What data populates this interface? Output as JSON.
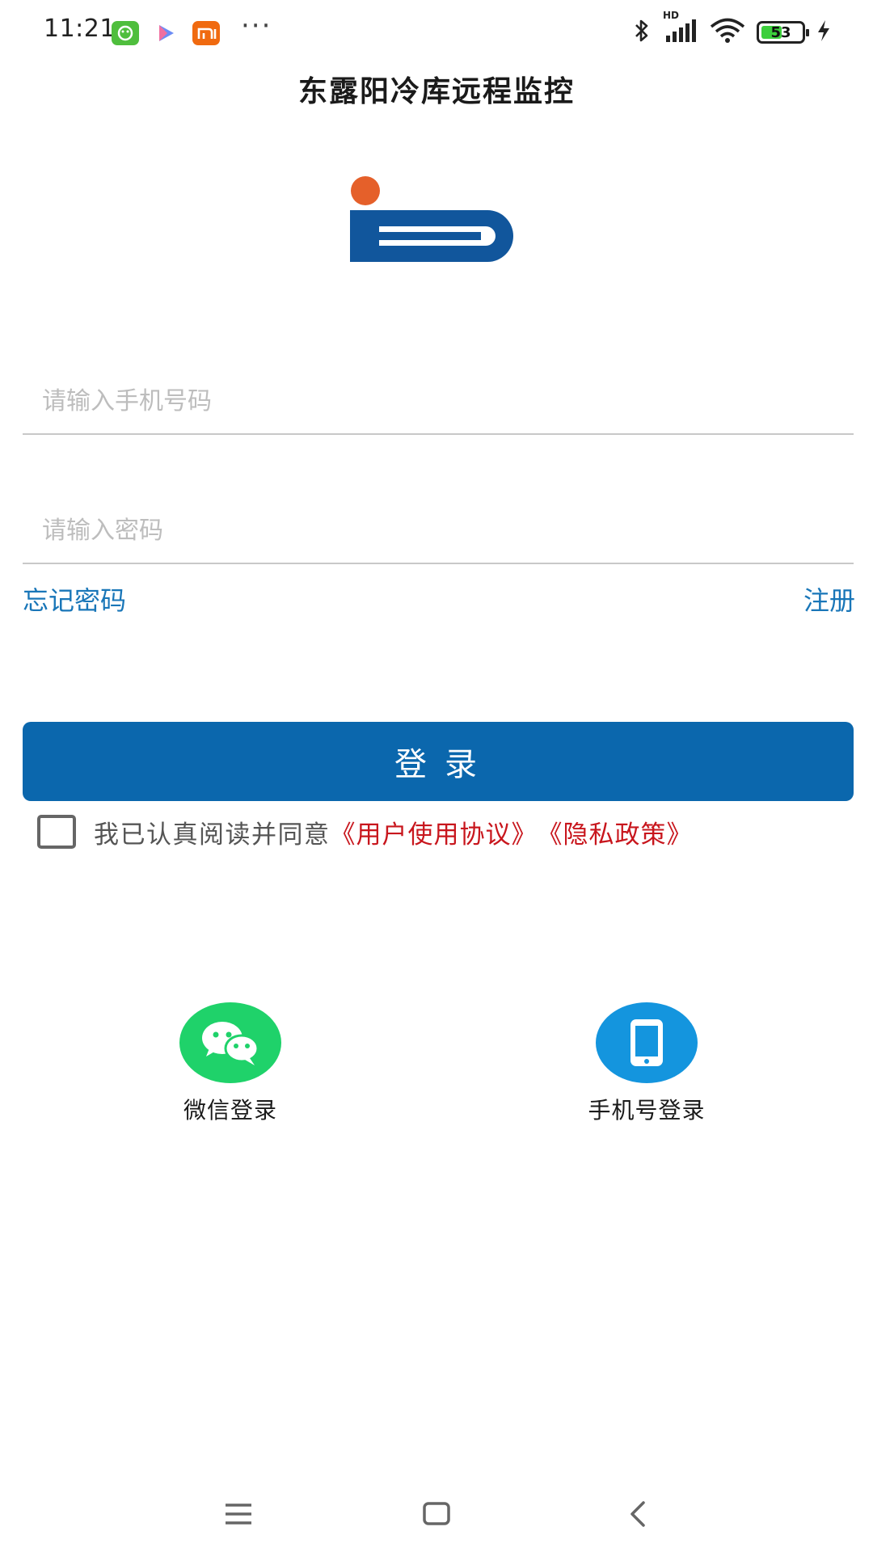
{
  "status_bar": {
    "time": "11:21",
    "more": "···",
    "battery": "53",
    "battery_level": 0.53,
    "hd_label": "HD"
  },
  "header": {
    "title": "东露阳冷库远程监控"
  },
  "colors": {
    "primary": "#0b67ad",
    "link": "#1976b8",
    "agreement_link": "#c8161d",
    "wechat": "#1fd26a",
    "phone": "#1495de",
    "logo_blue": "#11569c",
    "logo_orange": "#e5602a"
  },
  "form": {
    "phone_placeholder": "请输入手机号码",
    "password_placeholder": "请输入密码",
    "forgot_label": "忘记密码",
    "register_label": "注册",
    "login_label": "登录"
  },
  "agreement": {
    "text": "我已认真阅读并同意",
    "user_agreement": "《用户使用协议》",
    "privacy_policy": "《隐私政策》"
  },
  "alt_login": {
    "wechat_label": "微信登录",
    "wechat_icon": "wechat-icon",
    "phone_label": "手机号登录",
    "phone_icon": "mobile-phone-icon"
  },
  "nav": {
    "menu_icon": "menu-icon",
    "home_icon": "home-icon",
    "back_icon": "back-icon"
  }
}
